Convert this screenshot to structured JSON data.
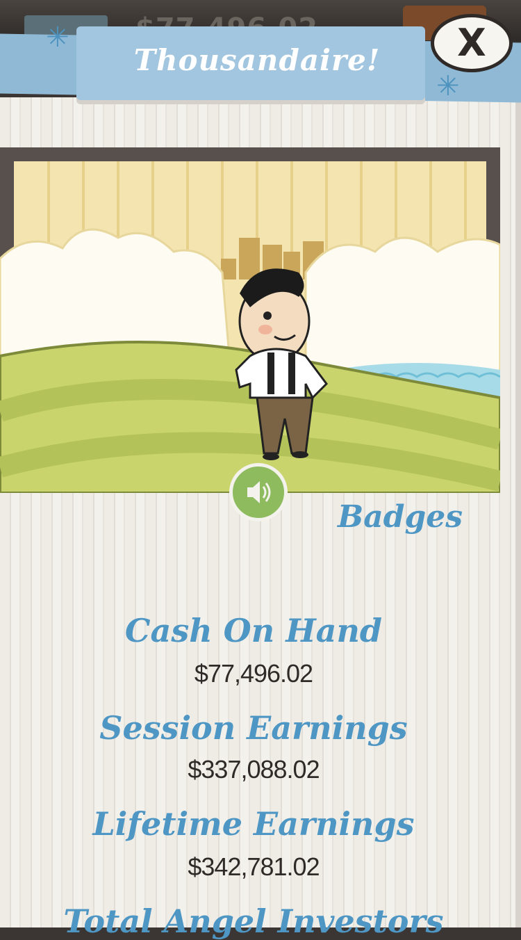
{
  "background": {
    "ghost_money": "$77,496.02"
  },
  "modal": {
    "title": "Thousandaire!",
    "close_label": "X",
    "badges_label": "Badges"
  },
  "stats": [
    {
      "label": "Cash On Hand",
      "value": "$77,496.02"
    },
    {
      "label": "Session Earnings",
      "value": "$337,088.02"
    },
    {
      "label": "Lifetime Earnings",
      "value": "$342,781.02"
    },
    {
      "label": "Total Angel Investors",
      "value": ""
    }
  ],
  "colors": {
    "accent_blue": "#4e96c4",
    "banner_blue": "#a2c6df",
    "sound_green": "#8dbb5e",
    "text_dark": "#2f2a27"
  },
  "icons": {
    "close": "close-icon",
    "sound": "speaker-icon",
    "snowflake": "sparkle-icon"
  }
}
